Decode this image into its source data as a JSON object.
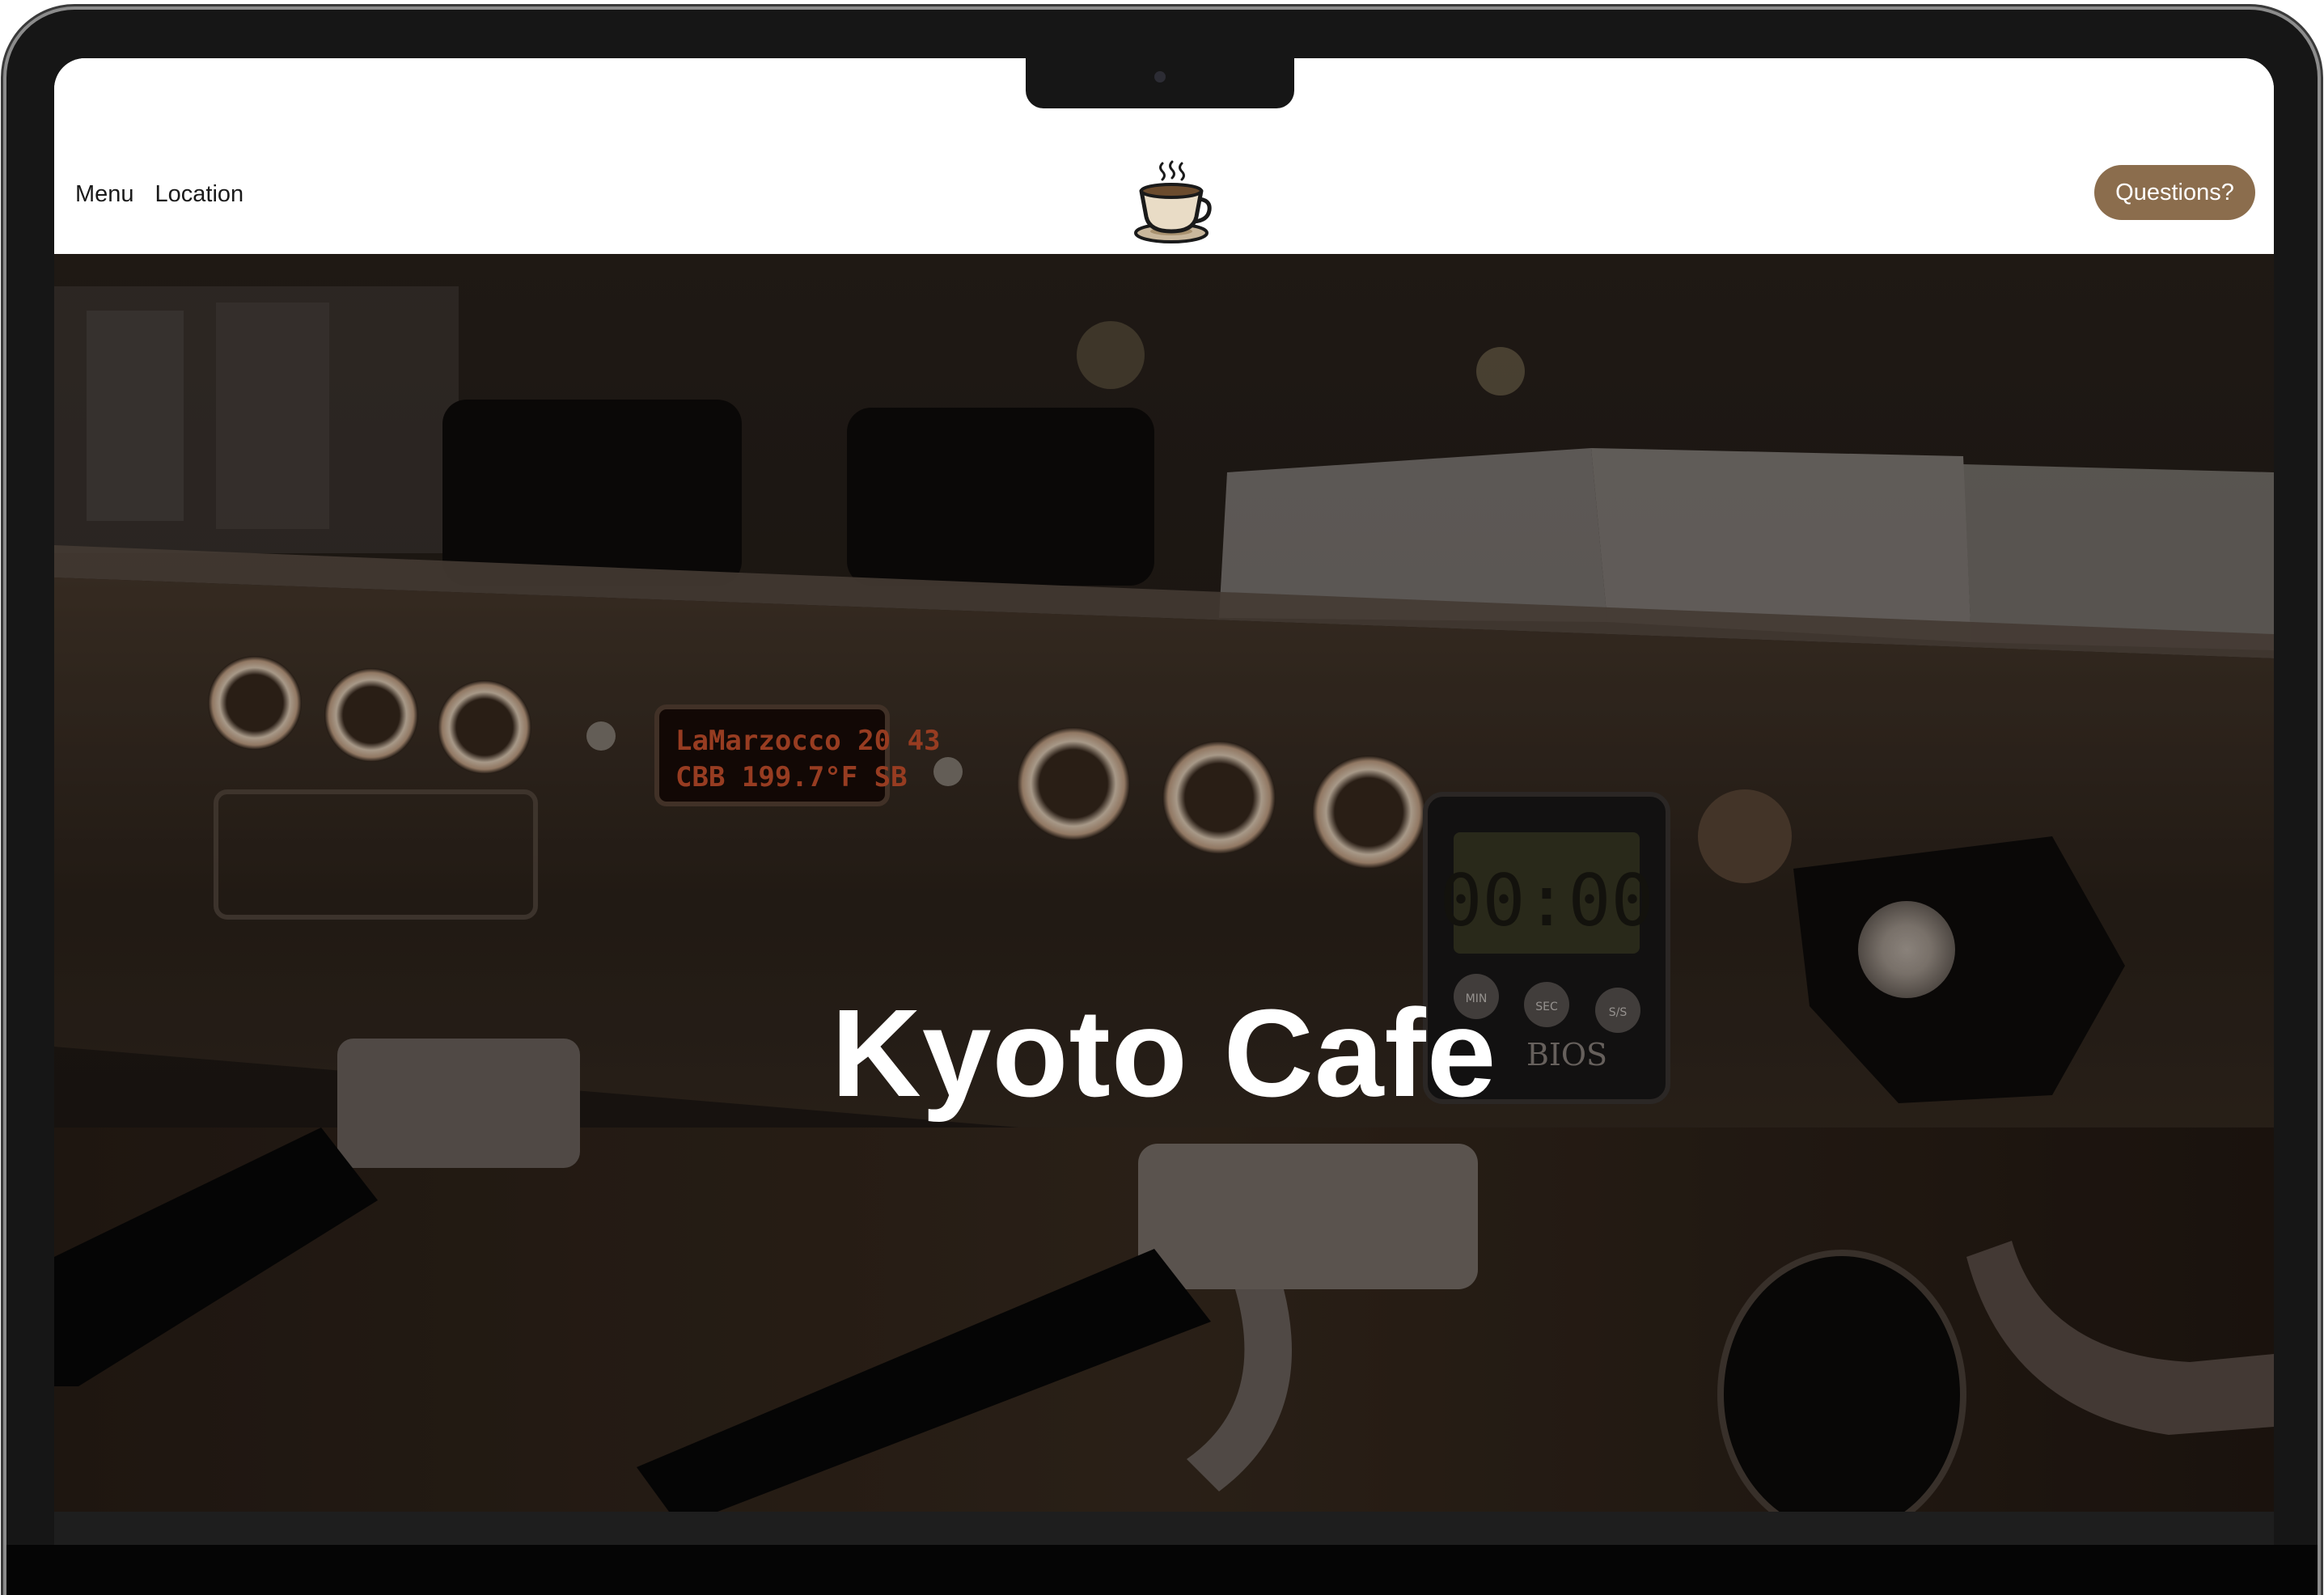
{
  "nav": {
    "links": [
      {
        "label": "Menu"
      },
      {
        "label": "Location"
      }
    ],
    "logo_icon": "coffee-cup-icon",
    "cta_label": "Questions?"
  },
  "hero": {
    "title": "Kyoto Cafe",
    "display": {
      "line1": "LaMarzocco 20 43",
      "line2": "CBB 199.7°F SB"
    },
    "timer_brand": "BIOS",
    "timer_digits": "00:00",
    "timer_buttons": [
      "MIN",
      "SEC",
      "S/S"
    ]
  },
  "colors": {
    "accent": "#8b6d4d",
    "nav_bg": "#ffffff",
    "hero_text": "#ffffff"
  }
}
